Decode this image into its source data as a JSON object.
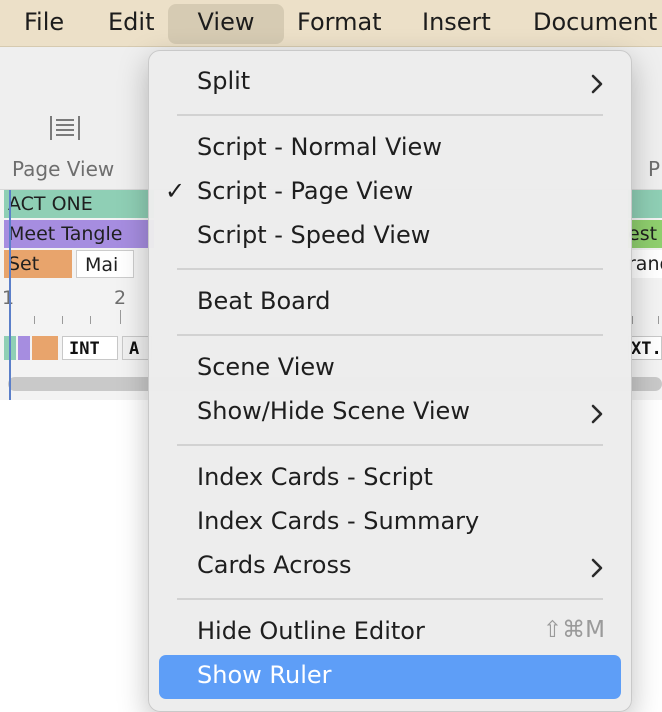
{
  "menubar": {
    "items": [
      "File",
      "Edit",
      "View",
      "Format",
      "Insert",
      "Document"
    ]
  },
  "toolbar": {
    "page_view_label": "Page View",
    "right_label_partial": "P"
  },
  "timeline": {
    "tracks": {
      "act": "ACT ONE",
      "scene": "Meet Tangle",
      "scene_right": "est",
      "sub1": "Set",
      "sub2": "Mai",
      "sub_right": "rand"
    },
    "ruler": [
      "1",
      "2"
    ],
    "chips": {
      "int": "INT",
      "a": "A",
      "ext": "XT."
    }
  },
  "view_menu": {
    "items": [
      {
        "label": "Split",
        "submenu": true
      },
      {
        "label": "Script - Normal View"
      },
      {
        "label": "Script - Page View",
        "checked": true
      },
      {
        "label": "Script - Speed View"
      },
      {
        "label": "Beat Board"
      },
      {
        "label": "Scene View"
      },
      {
        "label": "Show/Hide Scene View",
        "submenu": true
      },
      {
        "label": "Index Cards - Script"
      },
      {
        "label": "Index Cards - Summary"
      },
      {
        "label": "Cards Across",
        "submenu": true
      },
      {
        "label": "Hide Outline Editor",
        "shortcut": "⇧⌘M"
      },
      {
        "label": "Show Ruler",
        "highlighted": true
      }
    ],
    "check_glyph": "✓"
  },
  "colors": {
    "menubar_bg": "#ece0c8",
    "highlight": "#5e9ef7",
    "act_track": "#8fcfb5",
    "scene_track": "#a68de0",
    "set_chip": "#e8a46c"
  }
}
